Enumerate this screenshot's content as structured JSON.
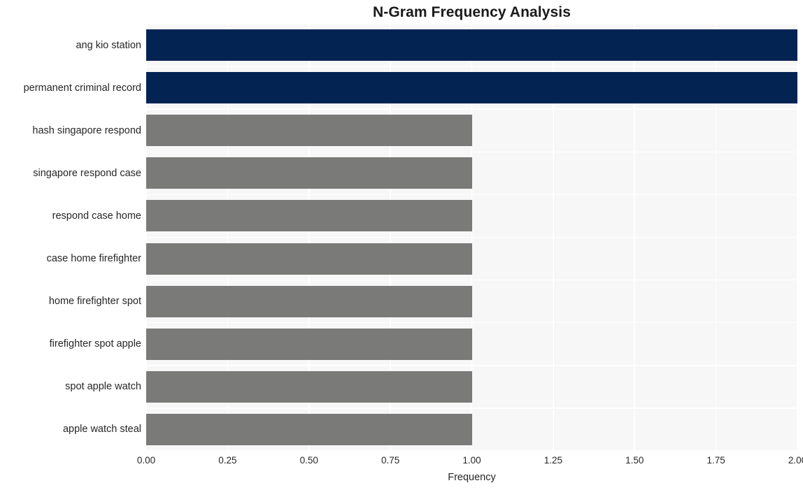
{
  "chart_data": {
    "type": "bar",
    "orientation": "horizontal",
    "title": "N-Gram Frequency Analysis",
    "xlabel": "Frequency",
    "ylabel": "",
    "xlim": [
      0,
      2
    ],
    "ylim": null,
    "grid": true,
    "legend": null,
    "xticks": [
      "0.00",
      "0.25",
      "0.50",
      "0.75",
      "1.00",
      "1.25",
      "1.50",
      "1.75",
      "2.00"
    ],
    "xtick_values": [
      0,
      0.25,
      0.5,
      0.75,
      1.0,
      1.25,
      1.5,
      1.75,
      2.0
    ],
    "categories": [
      "ang kio station",
      "permanent criminal record",
      "hash singapore respond",
      "singapore respond case",
      "respond case home",
      "case home firefighter",
      "home firefighter spot",
      "firefighter spot apple",
      "spot apple watch",
      "apple watch steal"
    ],
    "values": [
      2,
      2,
      1,
      1,
      1,
      1,
      1,
      1,
      1,
      1
    ],
    "bar_colors": [
      "#032352",
      "#032352",
      "#7a7a78",
      "#7a7a78",
      "#7a7a78",
      "#7a7a78",
      "#7a7a78",
      "#7a7a78",
      "#7a7a78",
      "#7a7a78"
    ],
    "plot_background": "#f7f7f8",
    "gridline_color": "#ffffff",
    "figure_background": "#ffffff",
    "text_color": "#262626",
    "title_color": "#1a1a1a"
  }
}
